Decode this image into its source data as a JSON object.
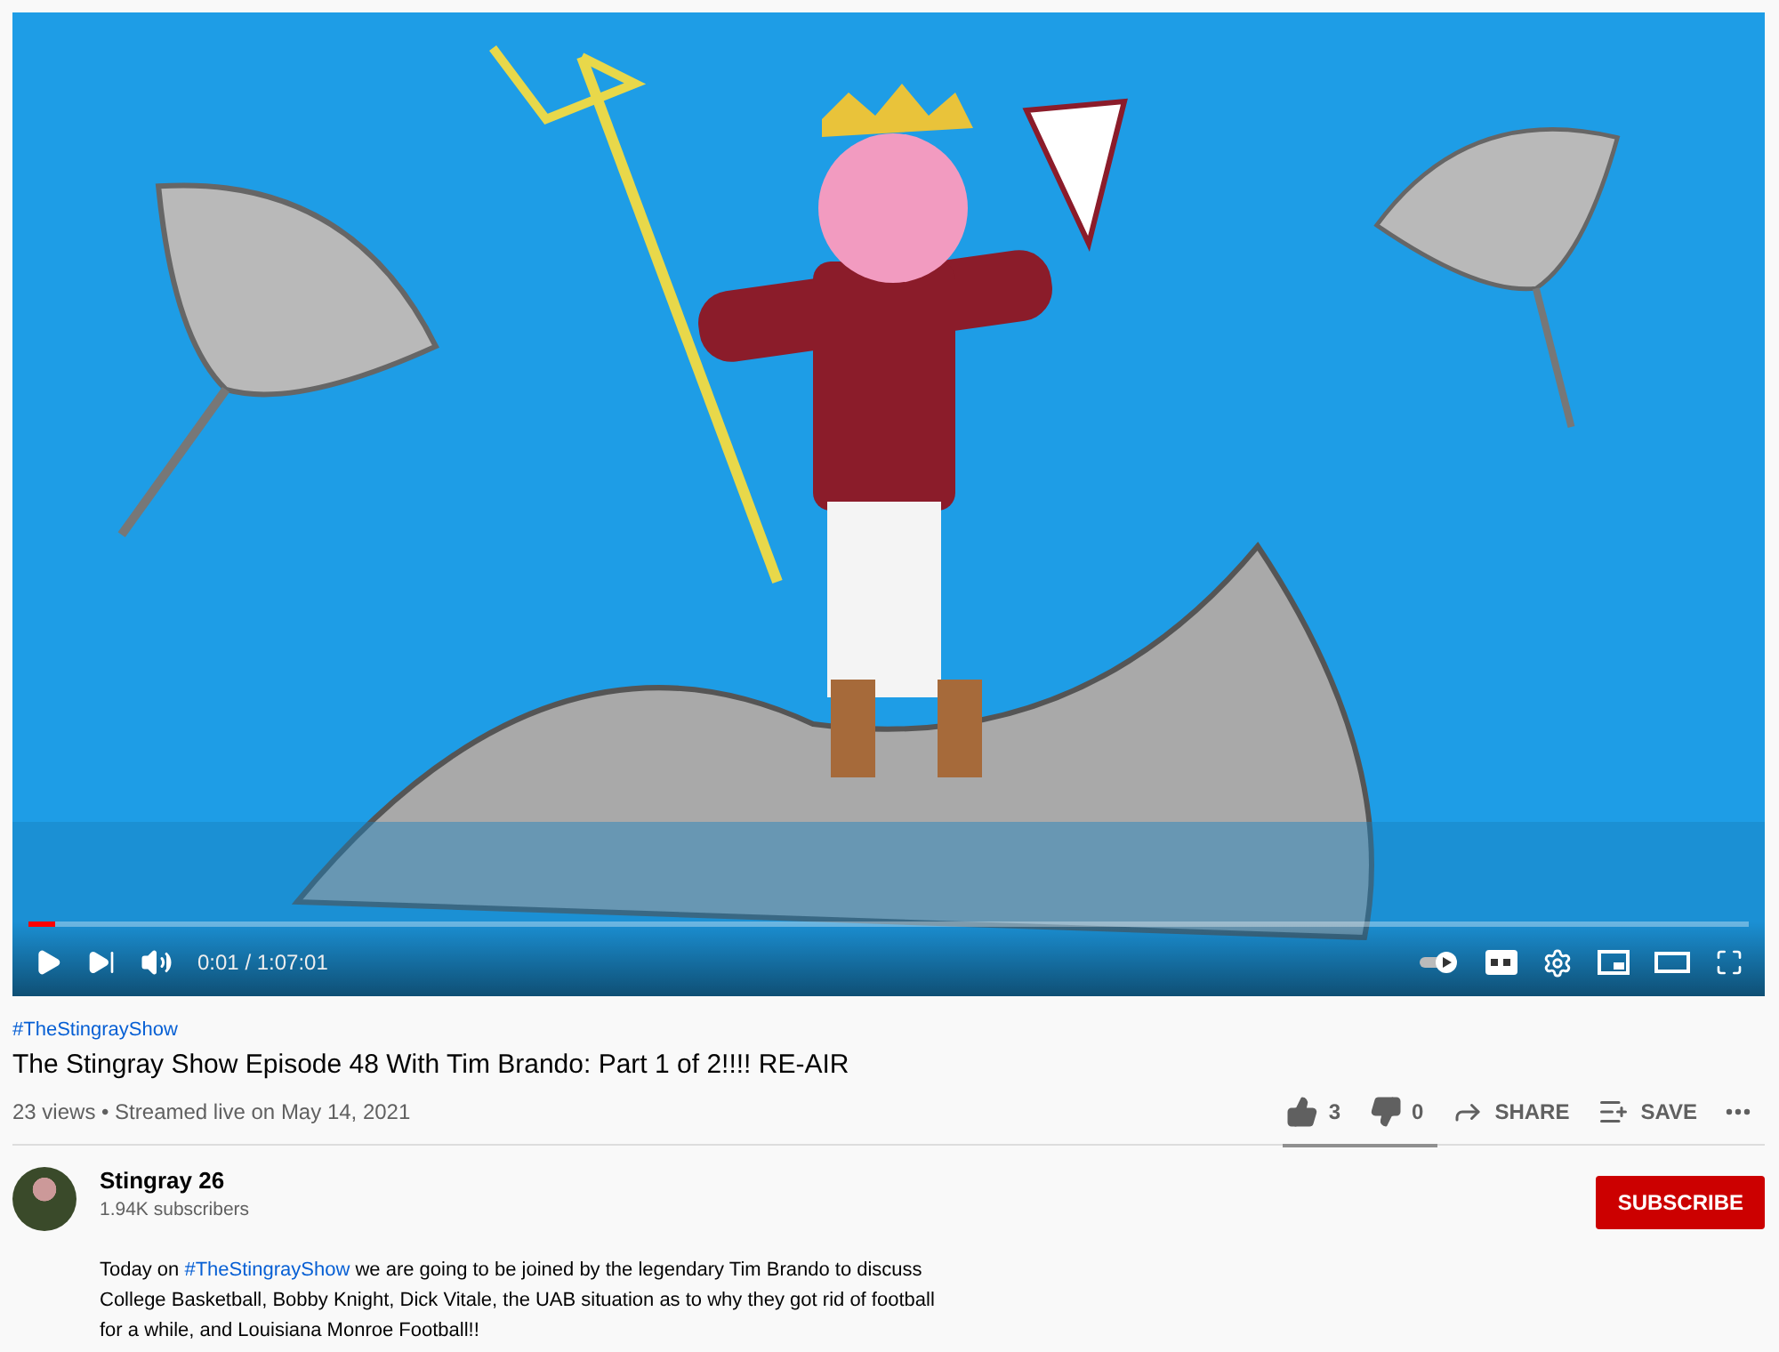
{
  "video": {
    "progress": {
      "level": 0.015
    },
    "time": "0:01 / 1:07:01"
  },
  "hashtag": "#TheStingrayShow",
  "title": "The Stingray Show Episode 48 With Tim Brando: Part 1 of 2!!!! RE-AIR",
  "meta": "23 views • Streamed live on May 14, 2021",
  "actions": {
    "likes": "3",
    "dislikes": "0",
    "share": "SHARE",
    "save": "SAVE",
    "sentiment": {
      "level": 1
    }
  },
  "channel": {
    "name": "Stingray 26",
    "subscribers": "1.94K subscribers",
    "subscribe": "SUBSCRIBE"
  },
  "description": {
    "before": "Today on ",
    "link": "#TheStingrayShow",
    "after": " we are going to be joined by the legendary Tim Brando to discuss College Basketball, Bobby Knight, Dick Vitale, the UAB situation as to why they got rid of football for a while, and Louisiana Monroe Football!!"
  }
}
